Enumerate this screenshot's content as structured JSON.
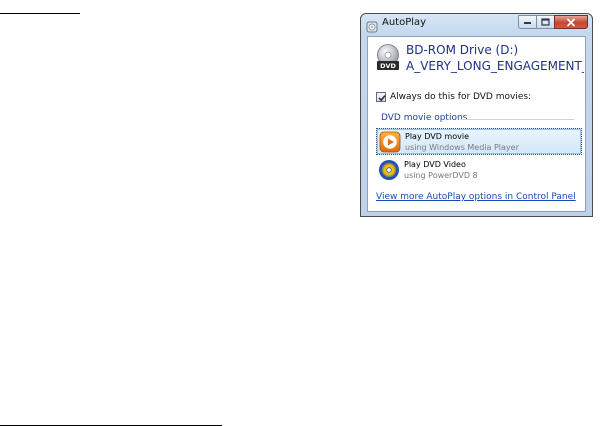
{
  "window": {
    "title": "AutoPlay",
    "app_icon": "autoplay-icon",
    "caption_icons": [
      "minimize-icon",
      "maximize-icon",
      "close-icon"
    ]
  },
  "drive": {
    "name": "BD-ROM Drive (D:)",
    "label": "A_VERY_LONG_ENGAGEMENT_DISC",
    "icon": "dvd-drive-icon",
    "icon_text": "DVD"
  },
  "always_checkbox": {
    "label": "Always do this for DVD movies:",
    "checked": true
  },
  "section": {
    "title": "DVD movie options"
  },
  "options": [
    {
      "title": "Play DVD movie",
      "subtitle": "using Windows Media Player",
      "icon": "windows-media-player-icon",
      "selected": true
    },
    {
      "title": "Play DVD Video",
      "subtitle": "using PowerDVD 8",
      "icon": "powerdvd-icon",
      "selected": false
    }
  ],
  "control_panel_link": "View more AutoPlay options in Control Panel",
  "colors": {
    "link": "#1a49b5",
    "heading": "#1e3287",
    "section": "#1e3e9e",
    "selection": "#d2e7f9",
    "close_button": "#c74531"
  }
}
